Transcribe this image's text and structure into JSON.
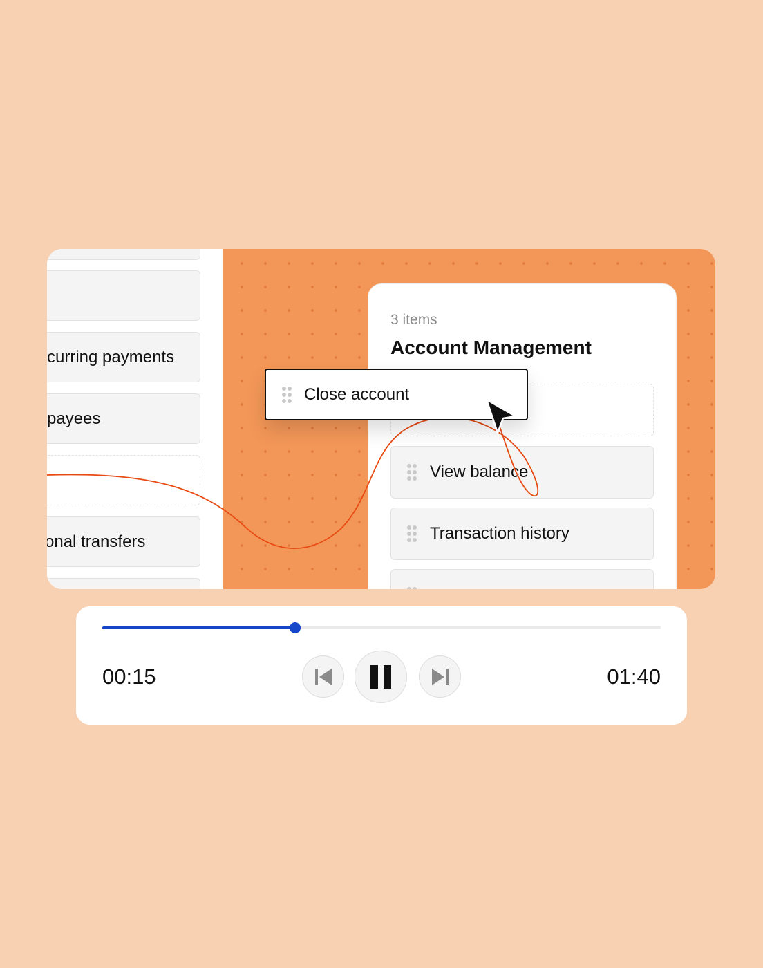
{
  "left_list": {
    "items": [
      {
        "label": ""
      },
      {
        "label": ""
      },
      {
        "label": "curring payments"
      },
      {
        "label": "payees"
      },
      {
        "label": "onal transfers"
      },
      {
        "label": ""
      }
    ]
  },
  "group": {
    "count_label": "3 items",
    "title": "Account Management",
    "items": [
      {
        "label": "View balance"
      },
      {
        "label": "Transaction history"
      },
      {
        "label": ""
      }
    ]
  },
  "dragged": {
    "label": "Close account"
  },
  "player": {
    "current_time": "00:15",
    "total_time": "01:40",
    "progress": 0.345,
    "accent_color": "#1546C9"
  },
  "colors": {
    "background": "#F8D0B2",
    "orange_panel": "#F39758",
    "curve": "#E84A12"
  },
  "icons": [
    "drag-handle-icon",
    "cursor-arrow-icon",
    "skip-previous-icon",
    "pause-icon",
    "skip-next-icon"
  ]
}
